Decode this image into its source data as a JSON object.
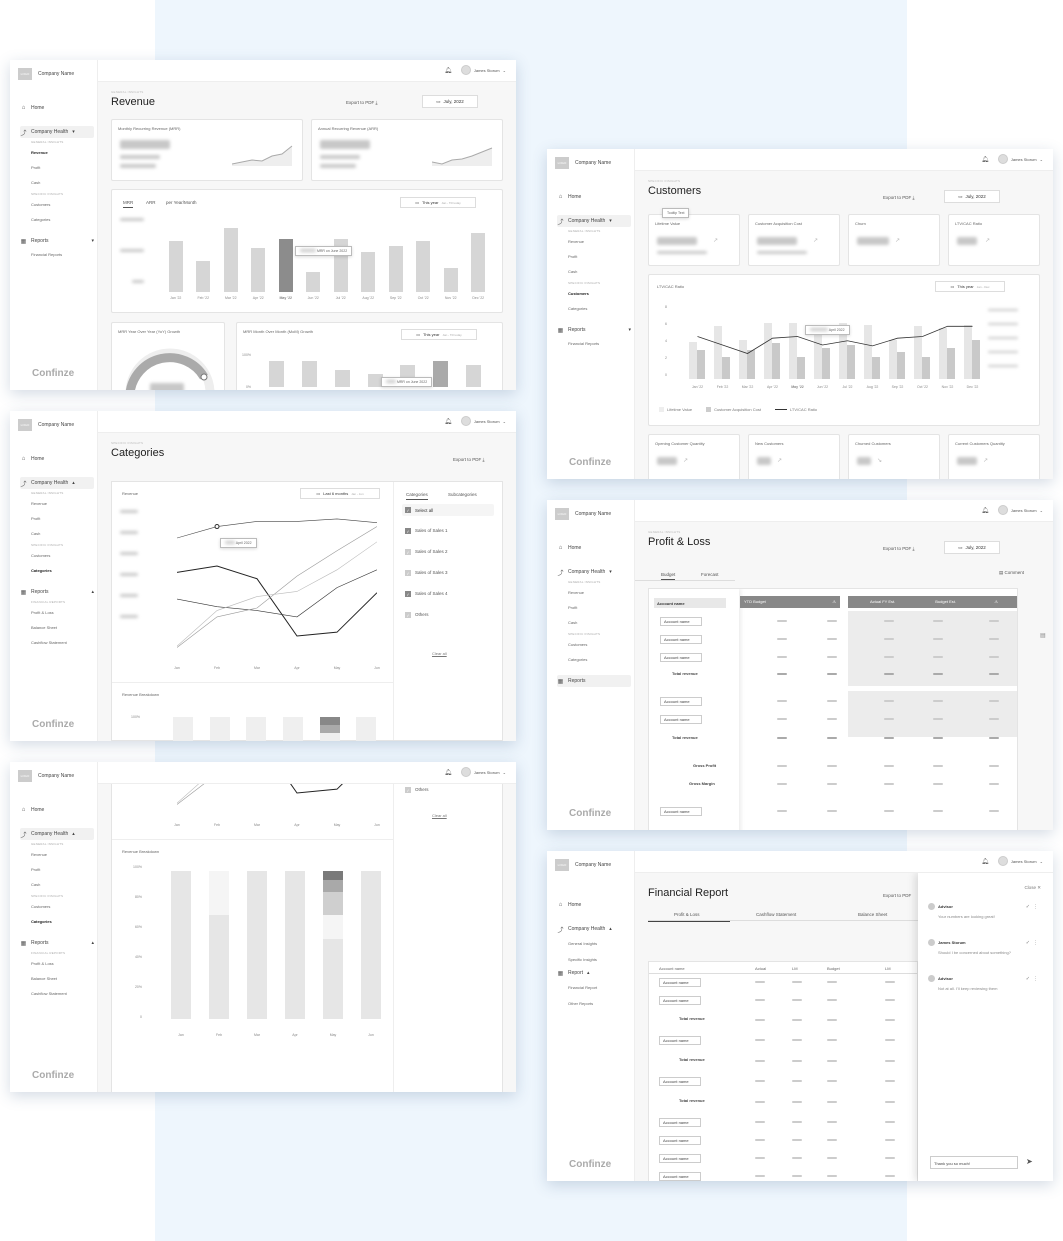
{
  "company": {
    "name": "Company Name",
    "logo_text": "LOGO",
    "brand": "Confinze"
  },
  "user": {
    "name": "James Storum"
  },
  "nav": {
    "home": "Home",
    "company_health": "Company Health",
    "general_insights_group": "GENERAL INSIGHTS",
    "revenue": "Revenue",
    "profit": "Profit",
    "cash": "Cash",
    "specific_insights_group": "SPECIFIC INSIGHTS",
    "customers": "Customers",
    "categories": "Categories",
    "reports": "Reports",
    "financial_reports": "Financial Reports",
    "financial_reports_group": "FINANCIAL REPORTS",
    "profit_loss": "Profit & Loss",
    "balance_sheet": "Balance Sheet",
    "cashflow_statement": "Cashflow Statement",
    "general_insights": "General Insights",
    "specific_insights": "Specific Insights",
    "report": "Report",
    "financial_report": "Financial Report",
    "other_reports": "Other Reports"
  },
  "common": {
    "export_pdf": "Export to PDF",
    "date": "July, 2022",
    "crumb": "GENERAL INSIGHTS",
    "crumb_specific": "SPECIFIC INSIGHTS",
    "this_year": "This year",
    "this_year_range": "Jan - Till today",
    "this_year_range2": "Jan - Dec"
  },
  "revenue_screen": {
    "title": "Revenue",
    "mrr_card": "Monthly Recurring Revenue (MRR)",
    "arr_card": "Annual Recurring Revenue (ARR)",
    "tab_mrr": "MRR",
    "tab_arr": "ARR",
    "per_label": "per Year/Month",
    "tooltip": "MRR on June 2022",
    "yoy": "MRR Year Over Year (YoY) Growth",
    "mom": "MRR Month Over Month (MoM) Growth",
    "tooltip2": "MRR on June 2022",
    "pct100": "100%",
    "pct0": "0%"
  },
  "categories_screen": {
    "title": "Categories",
    "revenue_label": "Revenue",
    "period": "Last 6 months",
    "period_range": "Jan - Jun",
    "tab_categories": "Categories",
    "tab_subcategories": "Subcategories",
    "select_all": "Select all",
    "items": [
      "Sales of Sales 1",
      "Sales of Sales 2",
      "Sales of Sales 3",
      "Sales of Sales 4",
      "Others"
    ],
    "clear_all": "Clear all",
    "tooltip": "April 2022",
    "breakdown": "Revenue Breakdown",
    "months": [
      "Jan",
      "Feb",
      "Mar",
      "Apr",
      "May",
      "Jun"
    ]
  },
  "breakdown_chart": {
    "yticks": [
      "100%",
      "80%",
      "60%",
      "40%",
      "20%",
      "0"
    ]
  },
  "customers_screen": {
    "title": "Customers",
    "tooltip_text": "Tooltip Text",
    "lifetime": "Lifetime Value",
    "cac": "Customer Acquisition Cost",
    "churn": "Churn",
    "ltv_cac_ratio": "LTV/CAC Ratio",
    "ltv_cac_chart": "LTV/CAC Ratio",
    "tooltip": "April 2022",
    "legend": [
      "Lifetime Value",
      "Customer Acquisition Cost",
      "LTV/CAC Ratio"
    ],
    "opening": "Opening Customer Quantity",
    "new": "New Customers",
    "churned": "Churned Customers",
    "current": "Current Customers Quantity"
  },
  "pl_screen": {
    "title": "Profit & Loss",
    "tab_budget": "Budget",
    "tab_forecast": "Forecast",
    "comment": "Comment",
    "account_name": "Account name",
    "ytd_budget": "YTD Budget",
    "actual_fy": "Actual FY Est.",
    "budget_est": "Budget Est.",
    "total_revenue": "Total revenue",
    "gross_profit": "Gross Profit",
    "gross_margin": "Gross Margin"
  },
  "fr_screen": {
    "title": "Financial Report",
    "tabs": [
      "Profit & Loss",
      "Cashflow Statement",
      "Balance Sheet"
    ],
    "cols": [
      "Account name",
      "Actual",
      "LM",
      "Budget",
      "LM"
    ],
    "close": "Close",
    "messages": [
      {
        "author": "Advisor",
        "text": "Your numbers are looking great!"
      },
      {
        "author": "James Storum",
        "text": "Should I be concerned about something?"
      },
      {
        "author": "Advisor",
        "text": "Not at all. I'll keep reviewing them"
      }
    ],
    "reply": "Thank you so much!"
  },
  "chart_data": [
    {
      "type": "bar",
      "categories": [
        "Jan '22",
        "Feb '22",
        "Mar '22",
        "Apr '22",
        "May '22",
        "Jun '22",
        "Jul '22",
        "Aug '22",
        "Sep '22",
        "Oct '22",
        "Nov '22",
        "Dec '22"
      ],
      "values": [
        46,
        28,
        58,
        40,
        48,
        18,
        48,
        36,
        42,
        46,
        22,
        54
      ],
      "highlight_index": 4
    },
    {
      "type": "bar",
      "values": [
        60,
        60,
        40,
        30,
        50,
        60,
        50
      ]
    },
    {
      "type": "line",
      "x": [
        "Jan",
        "Feb",
        "Mar",
        "Apr",
        "May",
        "Jun"
      ],
      "series": [
        {
          "values": [
            8.8,
            9.7,
            10.1,
            10.1,
            10.3,
            10.0
          ]
        },
        {
          "values": [
            6.1,
            6.6,
            5.6,
            1.1,
            1.4,
            4.5
          ]
        },
        {
          "values": [
            4.0,
            3.4,
            3.1,
            2.6,
            4.9,
            6.3
          ]
        },
        {
          "values": [
            0.2,
            2.6,
            3.3,
            5.8,
            7.8,
            9.7
          ]
        },
        {
          "values": [
            0.3,
            3.1,
            4.2,
            4.6,
            6.3,
            8.5
          ]
        }
      ]
    },
    {
      "type": "bar",
      "categories": [
        "Jan",
        "Feb",
        "Mar",
        "Apr",
        "May",
        "Jun"
      ],
      "series": [
        {
          "values": [
            100,
            70,
            100,
            100,
            54,
            100
          ]
        },
        {
          "values": [
            0,
            30,
            0,
            0,
            16,
            0
          ]
        },
        {
          "values": [
            0,
            0,
            0,
            0,
            16,
            0
          ]
        },
        {
          "values": [
            0,
            0,
            0,
            0,
            8,
            0
          ]
        },
        {
          "values": [
            0,
            0,
            0,
            0,
            6,
            0
          ]
        }
      ],
      "ylim": [
        0,
        100
      ]
    },
    {
      "type": "bar",
      "categories": [
        "Jan '22",
        "Feb '22",
        "Mar '22",
        "Apr '22",
        "May '22",
        "Jun '22",
        "Jul '22",
        "Aug '22",
        "Sep '22",
        "Oct '22",
        "Nov '22",
        "Dec '22"
      ],
      "yticks": [
        0,
        2,
        4,
        6,
        8
      ],
      "series": [
        {
          "name": "Lifetime Value",
          "values": [
            4.4,
            6.2,
            4.6,
            6.6,
            6.6,
            6.2,
            6.6,
            6.4,
            4.6,
            6.2,
            6.0,
            6.4
          ]
        },
        {
          "name": "Customer Acquisition Cost",
          "values": [
            3.4,
            2.6,
            3.4,
            4.2,
            2.6,
            3.6,
            4.0,
            2.6,
            3.2,
            2.6,
            3.6,
            4.6
          ]
        },
        {
          "name": "LTV/CAC Ratio",
          "values": [
            5.0,
            4.0,
            3.0,
            4.8,
            5.0,
            4.0,
            4.5,
            3.9,
            4.8,
            5.0,
            6.2,
            6.2
          ]
        }
      ],
      "ylim": [
        0,
        8
      ]
    }
  ]
}
